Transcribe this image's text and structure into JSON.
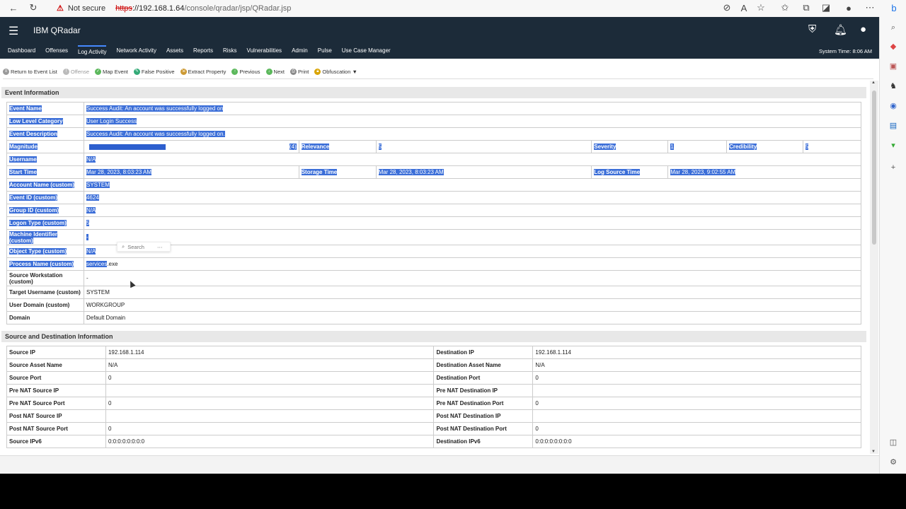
{
  "browser": {
    "warning": "Not secure",
    "url_https": "https",
    "url_host": "://192.168.1.64",
    "url_path": "/console/qradar/jsp/QRadar.jsp"
  },
  "app": {
    "brand": "IBM QRadar",
    "system_time": "System Time: 8:06 AM",
    "nav": [
      "Dashboard",
      "Offenses",
      "Log Activity",
      "Network Activity",
      "Assets",
      "Reports",
      "Risks",
      "Vulnerabilities",
      "Admin",
      "Pulse",
      "Use Case Manager"
    ],
    "active_nav": "Log Activity"
  },
  "toolbar": {
    "return": "Return to Event List",
    "offense": "Offense",
    "map_event": "Map Event",
    "false_positive": "False Positive",
    "extract_property": "Extract Property",
    "previous": "Previous",
    "next": "Next",
    "print": "Print",
    "obfuscation": "Obfuscation ▼"
  },
  "event_info": {
    "title": "Event Information",
    "event_name_label": "Event Name",
    "event_name": "Success Audit: An account was successfully logged on",
    "llc_label": "Low Level Category",
    "llc": "User Login Success",
    "desc_label": "Event Description",
    "desc": "Success Audit: An account was successfully logged on.",
    "magnitude_label": "Magnitude",
    "magnitude": "(4)",
    "relevance_label": "Relevance",
    "relevance": "5",
    "severity_label": "Severity",
    "severity": "1",
    "credibility_label": "Credibility",
    "credibility": "5",
    "username_label": "Username",
    "username": "N/A",
    "start_time_label": "Start Time",
    "start_time": "Mar 28, 2023, 8:03:23 AM",
    "storage_time_label": "Storage Time",
    "storage_time": "Mar 28, 2023, 8:03:23 AM",
    "log_source_time_label": "Log Source Time",
    "log_source_time": "Mar 28, 2023, 9:02:55 AM",
    "account_name_label": "Account Name (custom)",
    "account_name": "SYSTEM",
    "event_id_label": "Event ID (custom)",
    "event_id": "4624",
    "group_id_label": "Group ID (custom)",
    "group_id": "N/A",
    "logon_type_label": "Logon Type (custom)",
    "logon_type": "5",
    "machine_id_label": "Machine Identifier (custom)",
    "machine_id": "-",
    "object_type_label": "Object Type (custom)",
    "object_type": "N/A",
    "process_name_label": "Process Name (custom)",
    "process_name_sel": "services",
    "process_name_rest": ".exe",
    "source_ws_label": "Source Workstation (custom)",
    "source_ws": "-",
    "target_user_label": "Target Username (custom)",
    "target_user": "SYSTEM",
    "user_domain_label": "User Domain (custom)",
    "user_domain": "WORKGROUP",
    "domain_label": "Domain",
    "domain": "Default Domain",
    "mini_search": "Search"
  },
  "sd_info": {
    "title": "Source and Destination Information",
    "rows": [
      {
        "l1": "Source IP",
        "v1": "192.168.1.114",
        "l2": "Destination IP",
        "v2": "192.168.1.114"
      },
      {
        "l1": "Source Asset Name",
        "v1": "N/A",
        "l2": "Destination Asset Name",
        "v2": "N/A"
      },
      {
        "l1": "Source Port",
        "v1": "0",
        "l2": "Destination Port",
        "v2": "0"
      },
      {
        "l1": "Pre NAT Source IP",
        "v1": "",
        "l2": "Pre NAT Destination IP",
        "v2": ""
      },
      {
        "l1": "Pre NAT Source Port",
        "v1": "0",
        "l2": "Pre NAT Destination Port",
        "v2": "0"
      },
      {
        "l1": "Post NAT Source IP",
        "v1": "",
        "l2": "Post NAT Destination IP",
        "v2": ""
      },
      {
        "l1": "Post NAT Source Port",
        "v1": "0",
        "l2": "Post NAT Destination Port",
        "v2": "0"
      },
      {
        "l1": "Source IPv6",
        "v1": "0:0:0:0:0:0:0:0",
        "l2": "Destination IPv6",
        "v2": "0:0:0:0:0:0:0:0"
      }
    ]
  }
}
